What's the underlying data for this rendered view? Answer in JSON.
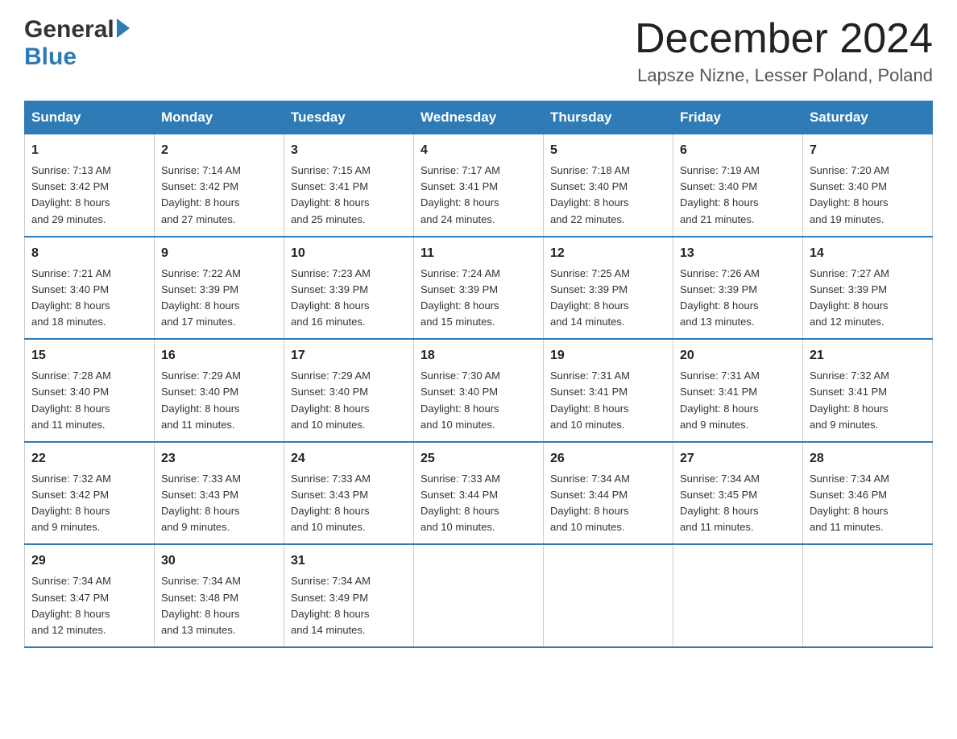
{
  "header": {
    "logo_general": "General",
    "logo_blue": "Blue",
    "month_title": "December 2024",
    "location": "Lapsze Nizne, Lesser Poland, Poland"
  },
  "weekdays": [
    "Sunday",
    "Monday",
    "Tuesday",
    "Wednesday",
    "Thursday",
    "Friday",
    "Saturday"
  ],
  "weeks": [
    [
      {
        "day": "1",
        "sunrise": "7:13 AM",
        "sunset": "3:42 PM",
        "daylight": "8 hours and 29 minutes."
      },
      {
        "day": "2",
        "sunrise": "7:14 AM",
        "sunset": "3:42 PM",
        "daylight": "8 hours and 27 minutes."
      },
      {
        "day": "3",
        "sunrise": "7:15 AM",
        "sunset": "3:41 PM",
        "daylight": "8 hours and 25 minutes."
      },
      {
        "day": "4",
        "sunrise": "7:17 AM",
        "sunset": "3:41 PM",
        "daylight": "8 hours and 24 minutes."
      },
      {
        "day": "5",
        "sunrise": "7:18 AM",
        "sunset": "3:40 PM",
        "daylight": "8 hours and 22 minutes."
      },
      {
        "day": "6",
        "sunrise": "7:19 AM",
        "sunset": "3:40 PM",
        "daylight": "8 hours and 21 minutes."
      },
      {
        "day": "7",
        "sunrise": "7:20 AM",
        "sunset": "3:40 PM",
        "daylight": "8 hours and 19 minutes."
      }
    ],
    [
      {
        "day": "8",
        "sunrise": "7:21 AM",
        "sunset": "3:40 PM",
        "daylight": "8 hours and 18 minutes."
      },
      {
        "day": "9",
        "sunrise": "7:22 AM",
        "sunset": "3:39 PM",
        "daylight": "8 hours and 17 minutes."
      },
      {
        "day": "10",
        "sunrise": "7:23 AM",
        "sunset": "3:39 PM",
        "daylight": "8 hours and 16 minutes."
      },
      {
        "day": "11",
        "sunrise": "7:24 AM",
        "sunset": "3:39 PM",
        "daylight": "8 hours and 15 minutes."
      },
      {
        "day": "12",
        "sunrise": "7:25 AM",
        "sunset": "3:39 PM",
        "daylight": "8 hours and 14 minutes."
      },
      {
        "day": "13",
        "sunrise": "7:26 AM",
        "sunset": "3:39 PM",
        "daylight": "8 hours and 13 minutes."
      },
      {
        "day": "14",
        "sunrise": "7:27 AM",
        "sunset": "3:39 PM",
        "daylight": "8 hours and 12 minutes."
      }
    ],
    [
      {
        "day": "15",
        "sunrise": "7:28 AM",
        "sunset": "3:40 PM",
        "daylight": "8 hours and 11 minutes."
      },
      {
        "day": "16",
        "sunrise": "7:29 AM",
        "sunset": "3:40 PM",
        "daylight": "8 hours and 11 minutes."
      },
      {
        "day": "17",
        "sunrise": "7:29 AM",
        "sunset": "3:40 PM",
        "daylight": "8 hours and 10 minutes."
      },
      {
        "day": "18",
        "sunrise": "7:30 AM",
        "sunset": "3:40 PM",
        "daylight": "8 hours and 10 minutes."
      },
      {
        "day": "19",
        "sunrise": "7:31 AM",
        "sunset": "3:41 PM",
        "daylight": "8 hours and 10 minutes."
      },
      {
        "day": "20",
        "sunrise": "7:31 AM",
        "sunset": "3:41 PM",
        "daylight": "8 hours and 9 minutes."
      },
      {
        "day": "21",
        "sunrise": "7:32 AM",
        "sunset": "3:41 PM",
        "daylight": "8 hours and 9 minutes."
      }
    ],
    [
      {
        "day": "22",
        "sunrise": "7:32 AM",
        "sunset": "3:42 PM",
        "daylight": "8 hours and 9 minutes."
      },
      {
        "day": "23",
        "sunrise": "7:33 AM",
        "sunset": "3:43 PM",
        "daylight": "8 hours and 9 minutes."
      },
      {
        "day": "24",
        "sunrise": "7:33 AM",
        "sunset": "3:43 PM",
        "daylight": "8 hours and 10 minutes."
      },
      {
        "day": "25",
        "sunrise": "7:33 AM",
        "sunset": "3:44 PM",
        "daylight": "8 hours and 10 minutes."
      },
      {
        "day": "26",
        "sunrise": "7:34 AM",
        "sunset": "3:44 PM",
        "daylight": "8 hours and 10 minutes."
      },
      {
        "day": "27",
        "sunrise": "7:34 AM",
        "sunset": "3:45 PM",
        "daylight": "8 hours and 11 minutes."
      },
      {
        "day": "28",
        "sunrise": "7:34 AM",
        "sunset": "3:46 PM",
        "daylight": "8 hours and 11 minutes."
      }
    ],
    [
      {
        "day": "29",
        "sunrise": "7:34 AM",
        "sunset": "3:47 PM",
        "daylight": "8 hours and 12 minutes."
      },
      {
        "day": "30",
        "sunrise": "7:34 AM",
        "sunset": "3:48 PM",
        "daylight": "8 hours and 13 minutes."
      },
      {
        "day": "31",
        "sunrise": "7:34 AM",
        "sunset": "3:49 PM",
        "daylight": "8 hours and 14 minutes."
      },
      null,
      null,
      null,
      null
    ]
  ],
  "labels": {
    "sunrise": "Sunrise: ",
    "sunset": "Sunset: ",
    "daylight": "Daylight: "
  }
}
